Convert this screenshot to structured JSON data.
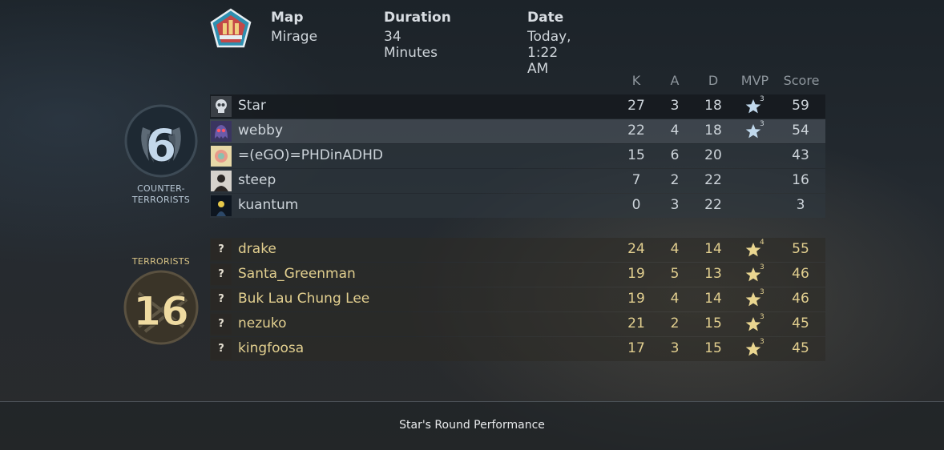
{
  "header": {
    "map_label": "Map",
    "map_value": "Mirage",
    "duration_label": "Duration",
    "duration_value": "34 Minutes",
    "date_label": "Date",
    "date_value": "Today, 1:22 AM",
    "map_icon": "mirage-map-icon"
  },
  "columns": {
    "k": "K",
    "a": "A",
    "d": "D",
    "mvp": "MVP",
    "score": "Score"
  },
  "ct": {
    "score": "6",
    "name_line1": "COUNTER-",
    "name_line2": "TERRORISTS",
    "color": "#b8cfe2",
    "players": [
      {
        "name": "Star",
        "k": "27",
        "a": "3",
        "d": "18",
        "mvp": "3",
        "score": "59",
        "avatar": "skull-avatar"
      },
      {
        "name": "webby",
        "k": "22",
        "a": "4",
        "d": "18",
        "mvp": "3",
        "score": "54",
        "avatar": "ghost-avatar"
      },
      {
        "name": "=(eGO)=PHDinADHD",
        "k": "15",
        "a": "6",
        "d": "20",
        "mvp": "",
        "score": "43",
        "avatar": "pattern-avatar"
      },
      {
        "name": "steep",
        "k": "7",
        "a": "2",
        "d": "22",
        "mvp": "",
        "score": "16",
        "avatar": "person-avatar"
      },
      {
        "name": "kuantum",
        "k": "0",
        "a": "3",
        "d": "22",
        "mvp": "",
        "score": "3",
        "avatar": "glow-avatar"
      }
    ]
  },
  "t": {
    "score": "16",
    "name": "TERRORISTS",
    "color": "#e2cf8f",
    "players": [
      {
        "name": "drake",
        "k": "24",
        "a": "4",
        "d": "14",
        "mvp": "4",
        "score": "55",
        "avatar": "?"
      },
      {
        "name": "Santa_Greenman",
        "k": "19",
        "a": "5",
        "d": "13",
        "mvp": "3",
        "score": "46",
        "avatar": "?"
      },
      {
        "name": "Buk Lau Chung Lee",
        "k": "19",
        "a": "4",
        "d": "14",
        "mvp": "3",
        "score": "46",
        "avatar": "?"
      },
      {
        "name": "nezuko",
        "k": "21",
        "a": "2",
        "d": "15",
        "mvp": "3",
        "score": "45",
        "avatar": "?"
      },
      {
        "name": "kingfoosa",
        "k": "17",
        "a": "3",
        "d": "15",
        "mvp": "3",
        "score": "45",
        "avatar": "?"
      }
    ]
  },
  "footer": {
    "performance_label": "Star's Round Performance"
  }
}
